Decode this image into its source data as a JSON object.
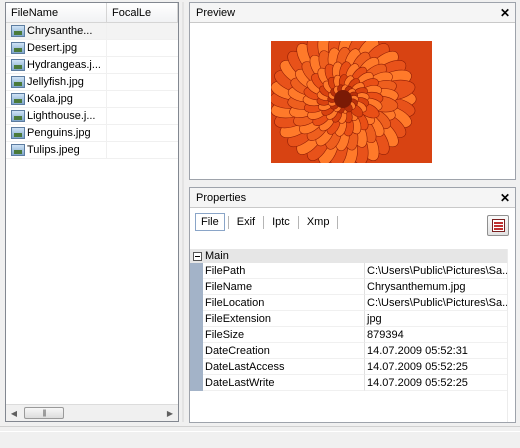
{
  "file_list": {
    "columns": [
      "FileName",
      "FocalLe"
    ],
    "files": [
      {
        "name": "Chrysanthe...",
        "focal": ""
      },
      {
        "name": "Desert.jpg",
        "focal": ""
      },
      {
        "name": "Hydrangeas.j...",
        "focal": ""
      },
      {
        "name": "Jellyfish.jpg",
        "focal": ""
      },
      {
        "name": "Koala.jpg",
        "focal": ""
      },
      {
        "name": "Lighthouse.j...",
        "focal": ""
      },
      {
        "name": "Penguins.jpg",
        "focal": ""
      },
      {
        "name": "Tulips.jpeg",
        "focal": ""
      }
    ],
    "selected_index": 0,
    "file_icon": "image-file-icon",
    "scrollbar_thumb_grip": "|||"
  },
  "preview": {
    "title": "Preview",
    "close_label": "✕",
    "image_subject": "orange chrysanthemum flower"
  },
  "properties": {
    "title": "Properties",
    "close_label": "✕",
    "tabs": [
      "File",
      "Exif",
      "Iptc",
      "Xmp"
    ],
    "active_tab": "File",
    "export_icon": "export-report-icon",
    "category": "Main",
    "rows": [
      {
        "name": "FilePath",
        "value": "C:\\Users\\Public\\Pictures\\Sa..."
      },
      {
        "name": "FileName",
        "value": "Chrysanthemum.jpg"
      },
      {
        "name": "FileLocation",
        "value": "C:\\Users\\Public\\Pictures\\Sa..."
      },
      {
        "name": "FileExtension",
        "value": "jpg"
      },
      {
        "name": "FileSize",
        "value": "879394"
      },
      {
        "name": "DateCreation",
        "value": "14.07.2009 05:52:31"
      },
      {
        "name": "DateLastAccess",
        "value": "14.07.2009 05:52:25"
      },
      {
        "name": "DateLastWrite",
        "value": "14.07.2009 05:52:25"
      }
    ]
  },
  "colors": {
    "property_margin": "#a3b3c8",
    "flower_dark": "#8e1d06",
    "flower_light": "#ff7a2a"
  }
}
